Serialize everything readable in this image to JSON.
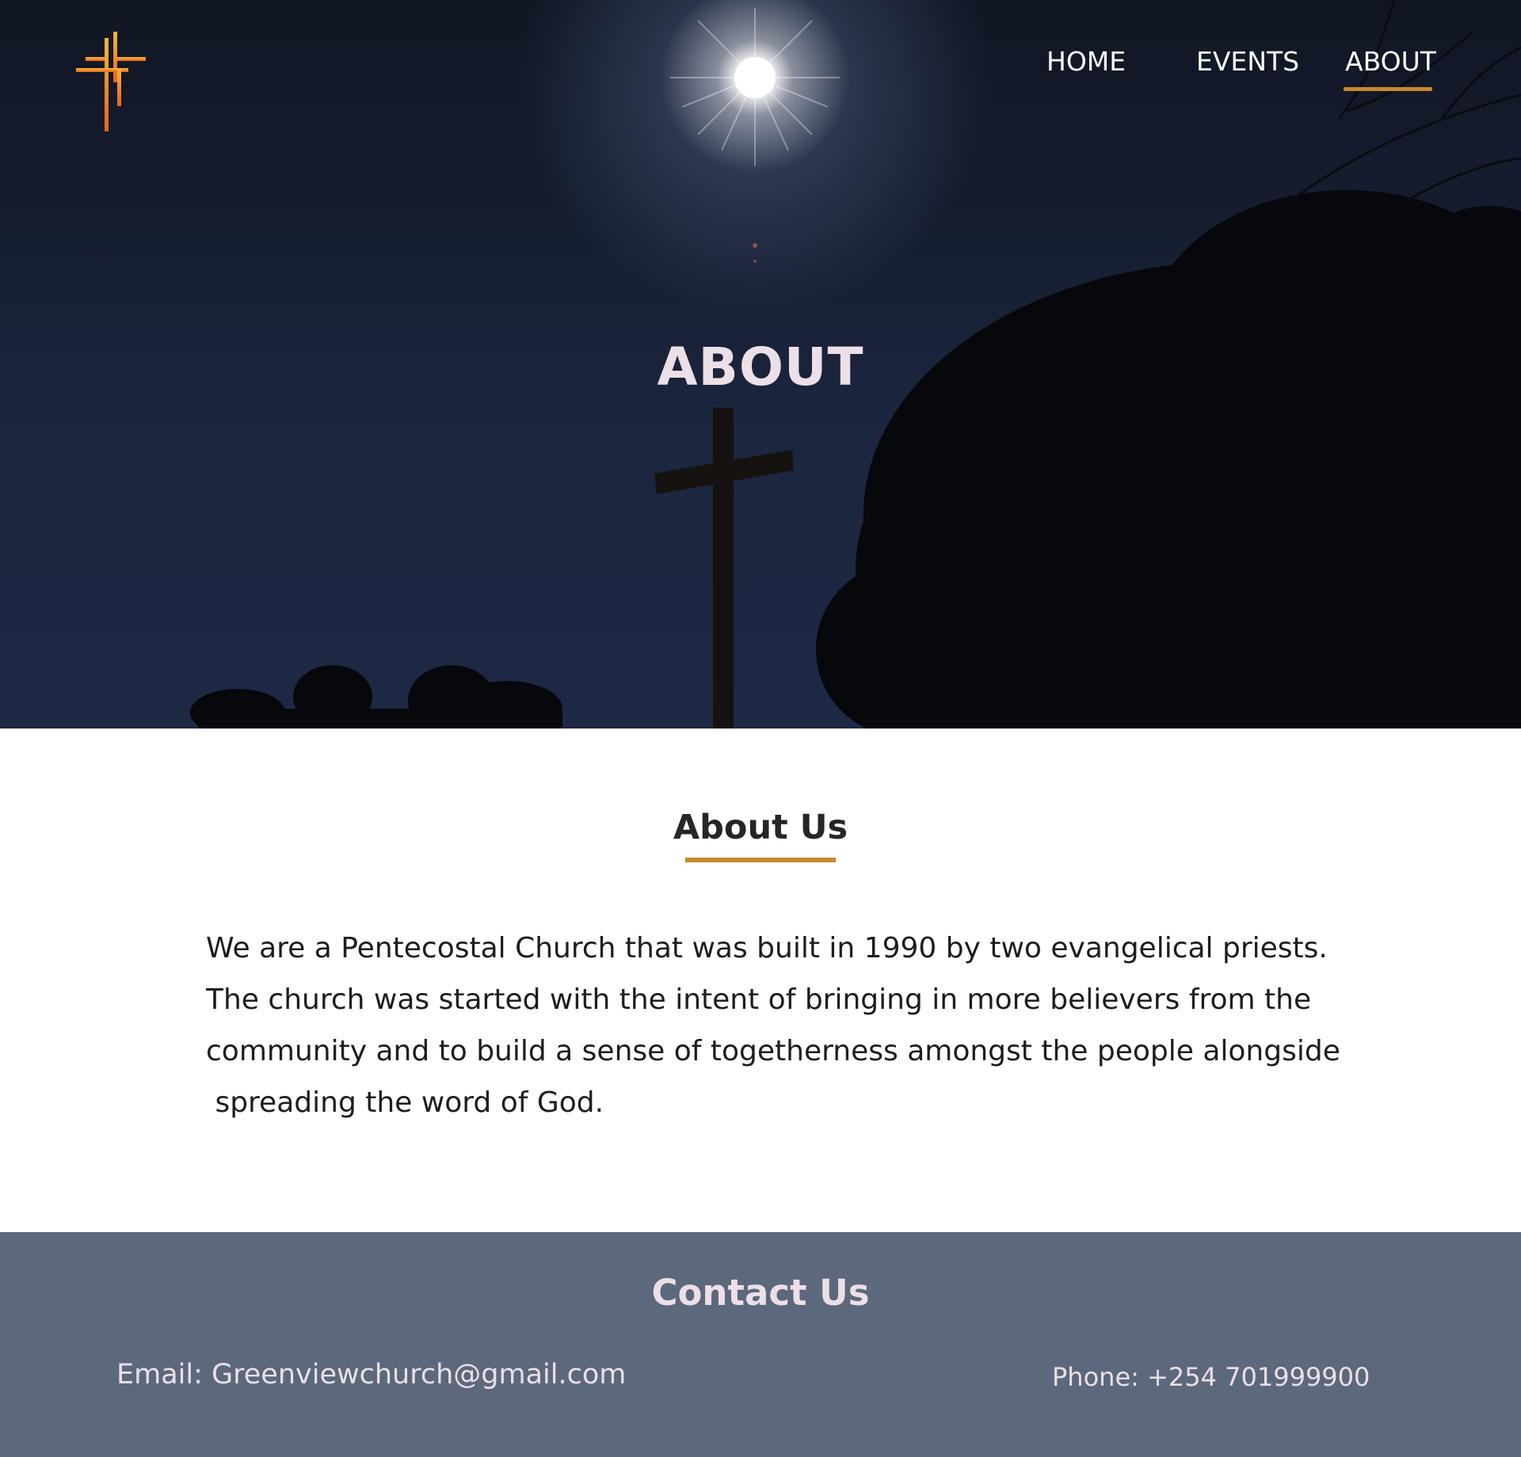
{
  "brand": {
    "logo_icon": "cross-logo-icon",
    "accent_color": "#c8882f"
  },
  "nav": {
    "items": [
      {
        "label": "HOME",
        "active": false
      },
      {
        "label": "EVENTS",
        "active": false
      },
      {
        "label": "ABOUT",
        "active": true
      }
    ]
  },
  "hero": {
    "title": "ABOUT"
  },
  "about": {
    "heading": "About Us",
    "lines": [
      "We are a Pentecostal Church that was built in 1990 by two evangelical priests.",
      "The church was started with the intent of bringing in more believers from the",
      "community and to build a sense of togetherness amongst the people alongside",
      " spreading the word of God."
    ]
  },
  "contact": {
    "heading": "Contact Us",
    "email": "Email: Greenviewchurch@gmail.com",
    "phone": "Phone: +254 701999900",
    "background_color": "#5c687c"
  }
}
